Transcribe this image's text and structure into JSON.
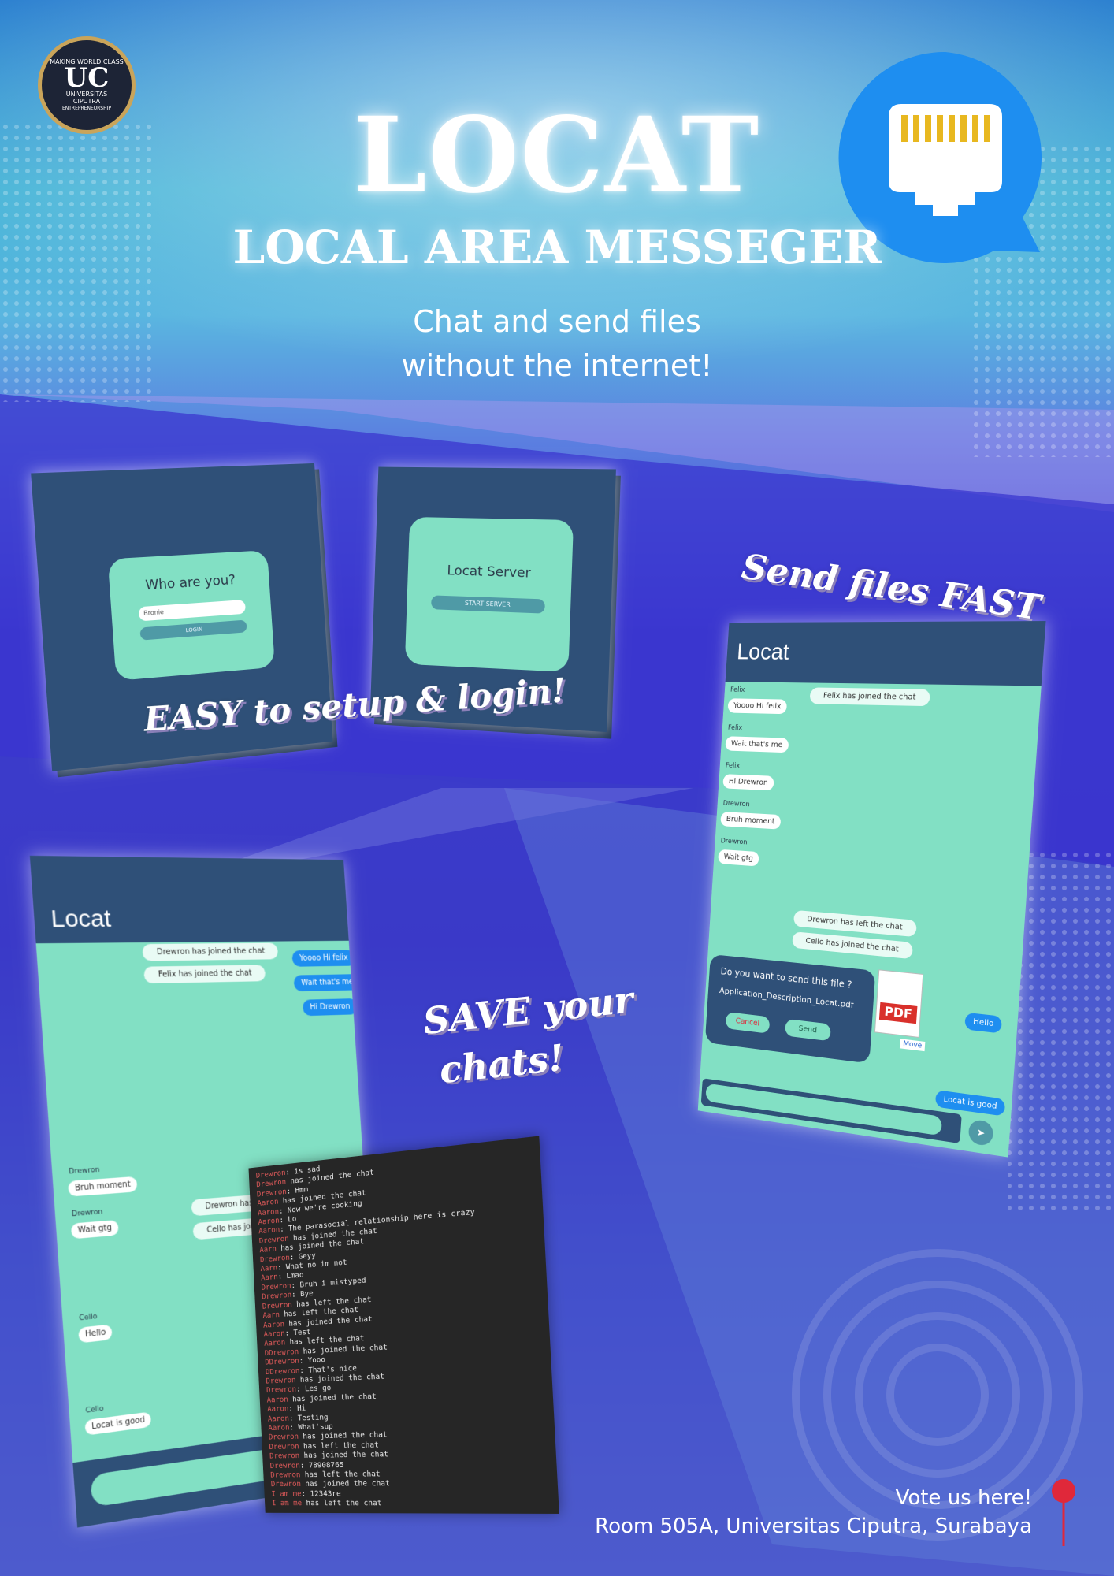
{
  "header": {
    "logo_main": "UC",
    "logo_top": "MAKING WORLD CLASS",
    "logo_name1": "UNIVERSITAS",
    "logo_name2": "CIPUTRA",
    "logo_bottom": "ENTREPRENEURSHIP",
    "title": "LOCAT",
    "subtitle": "LOCAL AREA MESSEGER",
    "tagline_line1": "Chat and send files",
    "tagline_line2": "without the internet!"
  },
  "callouts": {
    "easy": "EASY to setup & login!",
    "send_files": "Send files FAST",
    "save_line1": "SAVE your",
    "save_line2": "chats!"
  },
  "login_panel": {
    "heading": "Who are you?",
    "input_value": "Bronie",
    "button": "LOGIN"
  },
  "server_panel": {
    "heading": "Locat Server",
    "button": "START SERVER"
  },
  "chat_right": {
    "app_title": "Locat",
    "system_top": "Felix has joined the chat",
    "messages": [
      {
        "sender": "Felix",
        "text": "Yoooo Hi felix"
      },
      {
        "sender": "Felix",
        "text": "Wait that's me"
      },
      {
        "sender": "Felix",
        "text": "Hi Drewron"
      },
      {
        "sender": "Drewron",
        "text": "Bruh moment"
      },
      {
        "sender": "Drewron",
        "text": "Wait gtg"
      }
    ],
    "system_bottom": [
      "Drewron has left the chat",
      "Cello has joined the chat"
    ],
    "own_msgs": [
      "Hello",
      "Locat is good"
    ],
    "dialog": {
      "question": "Do you want to send this file ?",
      "filename": "Application_Description_Locat.pdf",
      "cancel": "Cancel",
      "send": "Send",
      "pdf_label": "PDF",
      "move": "Move"
    }
  },
  "chat_left": {
    "app_title": "Locat",
    "system_top": [
      "Drewron has joined the chat",
      "Felix has joined the chat"
    ],
    "own_msgs": [
      "Yoooo Hi felix",
      "Wait that's me",
      "Hi Drewron"
    ],
    "messages": [
      {
        "sender": "Drewron",
        "text": "Bruh moment"
      },
      {
        "sender": "Drewron",
        "text": "Wait gtg"
      },
      {
        "sender": "Cello",
        "text": "Hello"
      },
      {
        "sender": "Cello",
        "text": "Locat is good"
      }
    ],
    "system_mid": [
      "Drewron has left",
      "Cello has joined"
    ]
  },
  "terminal_lines": [
    {
      "n": "Drewron",
      "t": ": is sad"
    },
    {
      "n": "Drewron",
      "t": " has joined the chat"
    },
    {
      "n": "Drewron",
      "t": ": Hmm"
    },
    {
      "n": "Aaron",
      "t": " has joined the chat"
    },
    {
      "n": "Aaron",
      "t": ": Now we're cooking"
    },
    {
      "n": "Aaron",
      "t": ": Lo"
    },
    {
      "n": "Aaron",
      "t": ": The parasocial relationship here is crazy"
    },
    {
      "n": "Drewron",
      "t": " has joined the chat"
    },
    {
      "n": "Aarn",
      "t": " has joined the chat"
    },
    {
      "n": "Drewron",
      "t": ": Geyy"
    },
    {
      "n": "Aarn",
      "t": ": What no im not"
    },
    {
      "n": "Aarn",
      "t": ": Lmao"
    },
    {
      "n": "Drewron",
      "t": ": Bruh i mistyped"
    },
    {
      "n": "Drewron",
      "t": ": Bye"
    },
    {
      "n": "Drewron",
      "t": " has left the chat"
    },
    {
      "n": "Aarn",
      "t": " has left the chat"
    },
    {
      "n": "Aaron",
      "t": " has joined the chat"
    },
    {
      "n": "Aaron",
      "t": ": Test"
    },
    {
      "n": "Aaron",
      "t": " has left the chat"
    },
    {
      "n": "DDrewron",
      "t": " has joined the chat"
    },
    {
      "n": "DDrewron",
      "t": ": Yooo"
    },
    {
      "n": "DDrewron",
      "t": ": That's nice"
    },
    {
      "n": "Drewron",
      "t": " has joined the chat"
    },
    {
      "n": "Drewron",
      "t": ": Les go"
    },
    {
      "n": "Aaron",
      "t": " has joined the chat"
    },
    {
      "n": "Aaron",
      "t": ": Hi"
    },
    {
      "n": "Aaron",
      "t": ": Testing"
    },
    {
      "n": "Aaron",
      "t": ": What'sup"
    },
    {
      "n": "Drewron",
      "t": " has joined the chat"
    },
    {
      "n": "Drewron",
      "t": " has left the chat"
    },
    {
      "n": "Drewron",
      "t": " has joined the chat"
    },
    {
      "n": "Drewron",
      "t": ": 78908765"
    },
    {
      "n": "Drewron",
      "t": " has left the chat"
    },
    {
      "n": "Drewron",
      "t": " has joined the chat"
    },
    {
      "n": "I am me",
      "t": ": 12343re"
    },
    {
      "n": "I am me",
      "t": " has left the chat"
    }
  ],
  "footer": {
    "line1": "Vote us here!",
    "line2": "Room 505A, Universitas Ciputra, Surabaya"
  },
  "colors": {
    "panel": "#2f5078",
    "mint": "#82e0c4",
    "accent_blue": "#1e8ef0",
    "pin_red": "#e0283a"
  },
  "icons": [
    "ethernet-chat-icon",
    "map-pin-icon",
    "pdf-file-icon",
    "send-arrow-icon"
  ]
}
